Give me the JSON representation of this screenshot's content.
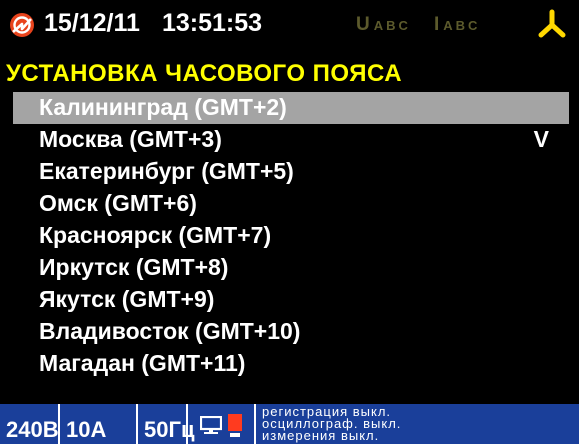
{
  "header": {
    "date": "15/12/11",
    "time": "13:51:53",
    "voltage_indicator": {
      "symbol": "U",
      "phases": "ABC"
    },
    "current_indicator": {
      "symbol": "I",
      "phases": "ABC"
    },
    "logo_icon": "power-logo-icon",
    "connection_icon": "network-star-icon"
  },
  "title": "УСТАНОВКА ЧАСОВОГО ПОЯСА",
  "timezones": [
    {
      "label": "Калининград (GMT+2)",
      "selected": true,
      "check": ""
    },
    {
      "label": "Москва (GMT+3)",
      "selected": false,
      "check": "V"
    },
    {
      "label": "Екатеринбург (GMT+5)",
      "selected": false,
      "check": ""
    },
    {
      "label": "Омск (GMT+6)",
      "selected": false,
      "check": ""
    },
    {
      "label": "Красноярск (GMT+7)",
      "selected": false,
      "check": ""
    },
    {
      "label": "Иркутск (GMT+8)",
      "selected": false,
      "check": ""
    },
    {
      "label": "Якутск (GMT+9)",
      "selected": false,
      "check": ""
    },
    {
      "label": "Владивосток (GMT+10)",
      "selected": false,
      "check": ""
    },
    {
      "label": "Магадан (GMT+11)",
      "selected": false,
      "check": ""
    }
  ],
  "statusbar": {
    "voltage": "240В",
    "current": "10А",
    "frequency": "50Гц",
    "device_icon": "pc-recording-icon",
    "status_lines": [
      "регистрация выкл.",
      "осциллограф. выкл.",
      "измерения выкл."
    ]
  },
  "colors": {
    "background": "#000000",
    "title": "#ffff00",
    "selection": "#a4a4a4",
    "statusbar": "#1a3f9a",
    "logo": "#e8431c",
    "phase_inactive": "#5c5a2c",
    "connection_icon": "#ffd800"
  }
}
